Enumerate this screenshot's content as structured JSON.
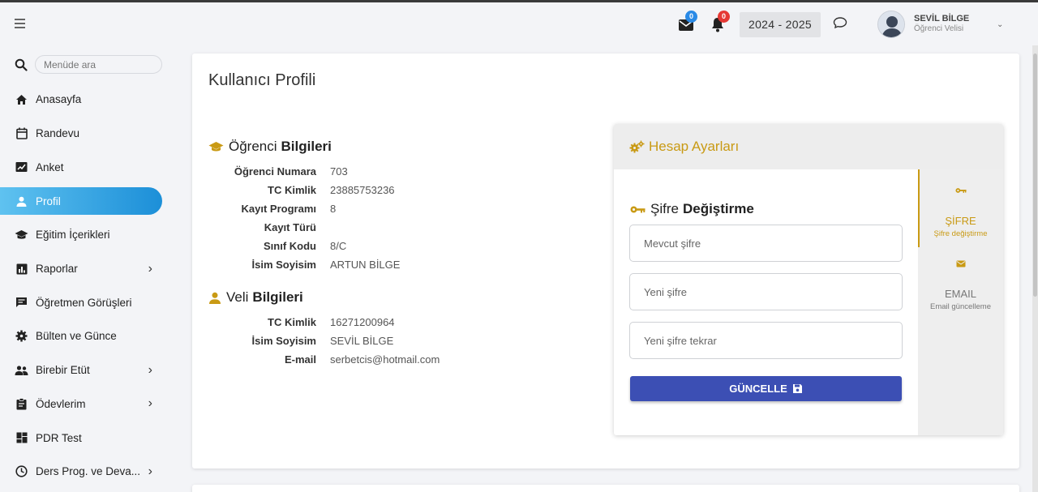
{
  "header": {
    "messages_badge": "0",
    "notifications_badge": "0",
    "year": "2024 - 2025",
    "user_name": "SEVİL BİLGE",
    "user_role": "Öğrenci Velisi"
  },
  "sidebar": {
    "search_placeholder": "Menüde ara",
    "items": [
      {
        "label": "Anasayfa",
        "icon": "home-icon"
      },
      {
        "label": "Randevu",
        "icon": "calendar-icon"
      },
      {
        "label": "Anket",
        "icon": "survey-icon"
      },
      {
        "label": "Profil",
        "icon": "person-icon"
      },
      {
        "label": "Eğitim İçerikleri",
        "icon": "graduation-cap-icon"
      },
      {
        "label": "Raporlar",
        "icon": "chart-icon"
      },
      {
        "label": "Öğretmen Görüşleri",
        "icon": "comment-icon"
      },
      {
        "label": "Bülten ve Günce",
        "icon": "gear-icon"
      },
      {
        "label": "Birebir Etüt",
        "icon": "people-icon"
      },
      {
        "label": "Ödevlerim",
        "icon": "clipboard-icon"
      },
      {
        "label": "PDR Test",
        "icon": "dashboard-icon"
      },
      {
        "label": "Ders Prog. ve Deva...",
        "icon": "clock-icon"
      }
    ]
  },
  "main": {
    "title": "Kullanıcı Profili",
    "student": {
      "title_light": "Öğrenci",
      "title_bold": "Bilgileri",
      "rows": [
        {
          "label": "Öğrenci Numara",
          "value": "703"
        },
        {
          "label": "TC Kimlik",
          "value": "23885753236"
        },
        {
          "label": "Kayıt Programı",
          "value": "8"
        },
        {
          "label": "Kayıt Türü",
          "value": ""
        },
        {
          "label": "Sınıf Kodu",
          "value": "8/C"
        },
        {
          "label": "İsim Soyisim",
          "value": "ARTUN BİLGE"
        }
      ]
    },
    "parent": {
      "title_light": "Veli",
      "title_bold": "Bilgileri",
      "rows": [
        {
          "label": "TC Kimlik",
          "value": "16271200964"
        },
        {
          "label": "İsim Soyisim",
          "value": "SEVİL BİLGE"
        },
        {
          "label": "E-mail",
          "value": "serbetcis@hotmail.com"
        }
      ]
    }
  },
  "settings": {
    "title": "Hesap Ayarları",
    "password": {
      "title_light": "Şifre",
      "title_bold": "Değiştirme",
      "current_placeholder": "Mevcut şifre",
      "new_placeholder": "Yeni şifre",
      "repeat_placeholder": "Yeni şifre tekrar",
      "button": "GÜNCELLE"
    },
    "tabs": [
      {
        "title": "ŞİFRE",
        "subtitle": "Şifre değiştirme",
        "icon": "key-icon"
      },
      {
        "title": "EMAIL",
        "subtitle": "Email güncelleme",
        "icon": "envelope-icon"
      }
    ]
  },
  "colors": {
    "accent_gold": "#c99a14",
    "button_blue": "#3c4fb4",
    "active_gradient_start": "#5fc2f0",
    "active_gradient_end": "#1c8fd8",
    "badge_blue": "#2a8ae6",
    "badge_red": "#e53935"
  }
}
